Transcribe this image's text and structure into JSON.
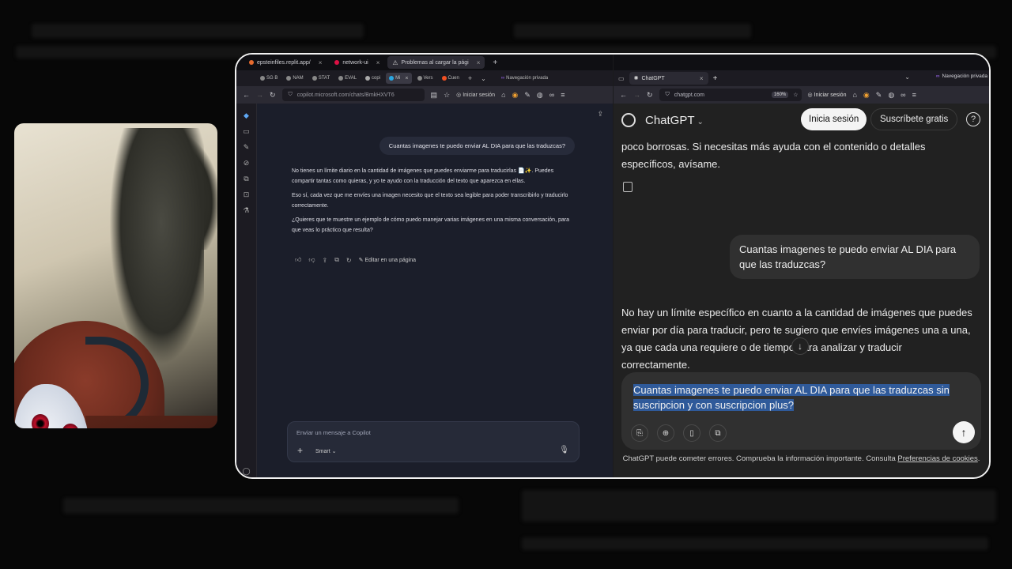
{
  "left_browser": {
    "window_tabs": [
      {
        "label": "epsteinfiles.replit.app/",
        "active": false
      },
      {
        "label": "network-ui",
        "active": false
      },
      {
        "label": "Problemas al cargar la pági",
        "active": true
      }
    ],
    "page_tabs": [
      {
        "label": "SG B"
      },
      {
        "label": "NAM"
      },
      {
        "label": "STAT"
      },
      {
        "label": "EVAL"
      },
      {
        "label": "copi"
      },
      {
        "label": "Mi"
      },
      {
        "label": "Vers"
      },
      {
        "label": "Cuen"
      }
    ],
    "private_label": "Navegación privada",
    "url": "copilot.microsoft.com/chats/BmkHXVT6",
    "signin_label": "Iniciar sesión",
    "user_message": "Cuantas imagenes te puedo enviar AL DIA para que las traduzcas?",
    "reply_paragraphs": [
      "No tienes un límite diario en la cantidad de imágenes que puedes enviarme para traducirlas 📄✨. Puedes compartir tantas como quieras, y yo te ayudo con la traducción del texto que aparezca en ellas.",
      "Eso sí, cada vez que me envíes una imagen necesito que el texto sea legible para poder transcribirlo y traducirlo correctamente.",
      "¿Quieres que te muestre un ejemplo de cómo puedo manejar varias imágenes en una misma conversación, para que veas lo práctico que resulta?"
    ],
    "edit_label": "Editar en una página",
    "input_placeholder": "Enviar un mensaje a Copilot",
    "mode_label": "Smart"
  },
  "right_browser": {
    "tab_label": "ChatGPT",
    "private_label": "Navegación privada",
    "url": "chatgpt.com",
    "zoom": "160%",
    "signin_label": "Iniciar sesión",
    "app_title": "ChatGPT",
    "login_button": "Inicia sesión",
    "subscribe_button": "Suscríbete gratis",
    "prev_answer_tail": "poco borrosas. Si necesitas más ayuda con el contenido o detalles específicos, avísame.",
    "user_question": "Cuantas imagenes te puedo enviar AL DIA para que las traduzcas?",
    "answer": "No hay un límite específico en cuanto a la cantidad de imágenes que puedes enviar por día para traducir, pero te sugiero que envíes imágenes una a una, ya que cada una requiere      o de tiempo para analizar y traducir correctamente.",
    "composer_text": "Cuantas imagenes te puedo enviar AL DIA para que las traduzcas sin suscripcion y con suscripcion plus?",
    "disclaimer": "ChatGPT puede cometer errores. Comprueba la información importante. Consulta",
    "disclaimer_link": "Preferencias de cookies",
    "disclaimer_end": "."
  }
}
